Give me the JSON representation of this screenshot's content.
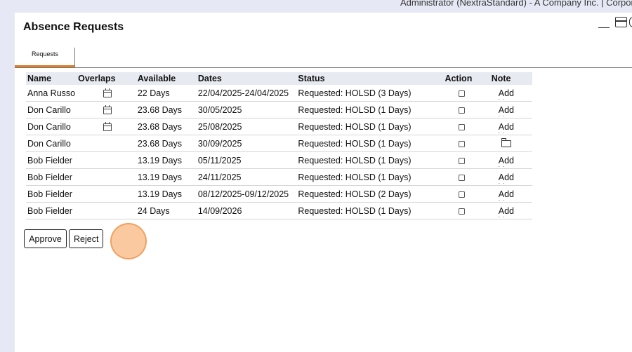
{
  "header": {
    "user_info": "Administrator (NextraStandard) - A Company Inc. | Corpora"
  },
  "page": {
    "title": "Absence Requests"
  },
  "tabs": [
    {
      "label": "Requests",
      "active": true
    }
  ],
  "table": {
    "columns": {
      "name": "Name",
      "overlaps": "Overlaps",
      "available": "Available",
      "dates": "Dates",
      "status": "Status",
      "action": "Action",
      "note": "Note"
    },
    "rows": [
      {
        "name": "Anna Russo",
        "overlap": true,
        "available": "22 Days",
        "dates": "22/04/2025-24/04/2025",
        "status": "Requested: HOLSD (3 Days)",
        "note": "Add"
      },
      {
        "name": "Don Carillo",
        "overlap": true,
        "available": "23.68 Days",
        "dates": "30/05/2025",
        "status": "Requested: HOLSD (1 Days)",
        "note": "Add"
      },
      {
        "name": "Don Carillo",
        "overlap": true,
        "available": "23.68 Days",
        "dates": "25/08/2025",
        "status": "Requested: HOLSD (1 Days)",
        "note": "Add"
      },
      {
        "name": "Don Carillo",
        "overlap": false,
        "available": "23.68 Days",
        "dates": "30/09/2025",
        "status": "Requested: HOLSD (1 Days)",
        "note": "folder-icon"
      },
      {
        "name": "Bob Fielder",
        "overlap": false,
        "available": "13.19 Days",
        "dates": "05/11/2025",
        "status": "Requested: HOLSD (1 Days)",
        "note": "Add"
      },
      {
        "name": "Bob Fielder",
        "overlap": false,
        "available": "13.19 Days",
        "dates": "24/11/2025",
        "status": "Requested: HOLSD (1 Days)",
        "note": "Add"
      },
      {
        "name": "Bob Fielder",
        "overlap": false,
        "available": "13.19 Days",
        "dates": "08/12/2025-09/12/2025",
        "status": "Requested: HOLSD (2 Days)",
        "note": "Add"
      },
      {
        "name": "Bob Fielder",
        "overlap": false,
        "available": "24 Days",
        "dates": "14/09/2026",
        "status": "Requested: HOLSD (1 Days)",
        "note": "Add"
      }
    ]
  },
  "buttons": {
    "approve": "Approve",
    "reject": "Reject"
  },
  "colors": {
    "accent": "#e07d2a",
    "background": "#e6e9f5",
    "header_row": "#e8eaf2"
  }
}
